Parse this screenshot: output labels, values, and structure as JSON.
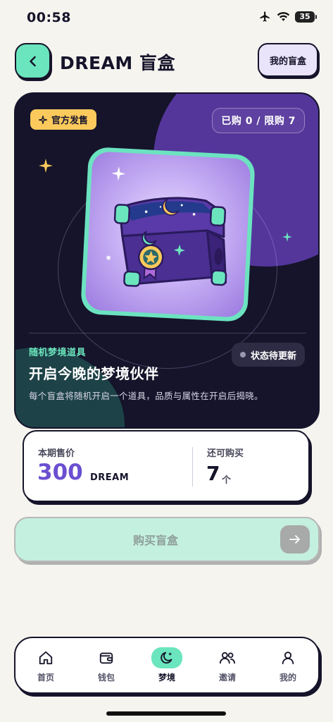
{
  "status_bar": {
    "time": "00:58",
    "battery": "35"
  },
  "header": {
    "title": "DREAM 盲盒",
    "my_box_label": "我的盲盒"
  },
  "hero": {
    "official_badge": "官方发售",
    "purchase_limit": "已购 0 / 限购 7",
    "category": "随机梦境道具",
    "status": "状态待更新",
    "title": "开启今晚的梦境伙伴",
    "description": "每个盲盒将随机开启一个道具，品质与属性在开启后揭晓。"
  },
  "price": {
    "label": "本期售价",
    "value": "300",
    "unit": "DREAM",
    "remain_label": "还可购买",
    "remain_value": "7",
    "remain_unit": "个"
  },
  "buy_button": {
    "label": "购买盲盒"
  },
  "nav": {
    "items": [
      {
        "label": "首页",
        "icon": "home-icon"
      },
      {
        "label": "钱包",
        "icon": "wallet-icon"
      },
      {
        "label": "梦境",
        "icon": "moon-icon"
      },
      {
        "label": "邀请",
        "icon": "users-icon"
      },
      {
        "label": "我的",
        "icon": "user-icon"
      }
    ],
    "active": "梦境"
  },
  "colors": {
    "accent_mint": "#6be5bd",
    "accent_purple": "#6a4fd0",
    "badge_yellow": "#fcca5c",
    "dark": "#15142a"
  }
}
